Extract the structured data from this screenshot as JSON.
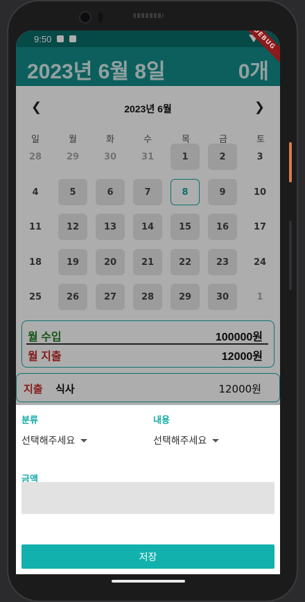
{
  "status_bar": {
    "time": "9:50"
  },
  "app_bar": {
    "title": "2023년 6월 8일",
    "count": "0개",
    "debug_label": "DEBUG"
  },
  "calendar": {
    "month_title": "2023년 6월",
    "prev_icon": "chevron-left-icon",
    "next_icon": "chevron-right-icon",
    "weekdays": [
      "일",
      "월",
      "화",
      "수",
      "목",
      "금",
      "토"
    ],
    "weeks": [
      [
        "28",
        "29",
        "30",
        "31",
        "1",
        "2",
        "3"
      ],
      [
        "4",
        "5",
        "6",
        "7",
        "8",
        "9",
        "10"
      ],
      [
        "11",
        "12",
        "13",
        "14",
        "15",
        "16",
        "17"
      ],
      [
        "18",
        "19",
        "20",
        "21",
        "22",
        "23",
        "24"
      ],
      [
        "25",
        "26",
        "27",
        "28",
        "29",
        "30",
        "1"
      ]
    ],
    "selected_day": "8"
  },
  "summary": {
    "income_label": "월 수입",
    "income_value": "100000원",
    "expense_label": "월 지출",
    "expense_value": "12000원"
  },
  "entry": {
    "category": "지출",
    "description": "식사",
    "amount": "12000원"
  },
  "form": {
    "category_label": "분류",
    "category_value": "선택해주세요",
    "content_label": "내용",
    "content_value": "선택해주세요",
    "amount_label": "금액",
    "amount_value": "",
    "save_label": "저장"
  },
  "colors": {
    "accent": "#12a9a5",
    "appbar": "#128d8a",
    "income": "#1f7d24",
    "expense": "#c62828"
  }
}
